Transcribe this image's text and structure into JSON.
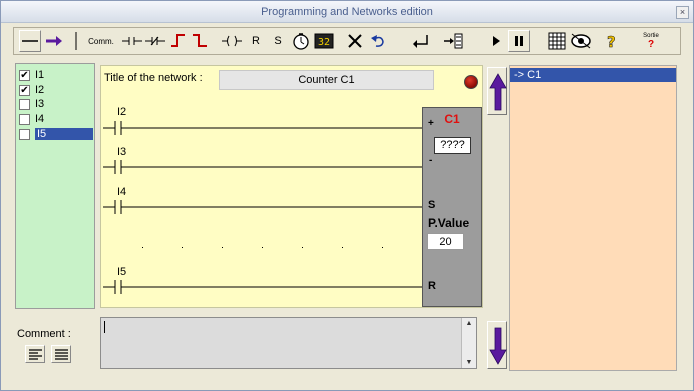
{
  "window": {
    "title": "Programming and Networks edition",
    "close_glyph": "×"
  },
  "toolbar": {
    "items": [
      {
        "name": "hline-tool",
        "text": ""
      },
      {
        "name": "arrow-tool",
        "text": ""
      },
      {
        "name": "vline-tool",
        "text": ""
      },
      {
        "name": "comment-tool",
        "text": "Comm."
      },
      {
        "name": "no-contact-tool",
        "text": ""
      },
      {
        "name": "nc-contact-tool",
        "text": ""
      },
      {
        "name": "rising-edge-tool",
        "text": ""
      },
      {
        "name": "falling-edge-tool",
        "text": ""
      },
      {
        "name": "coil-tool",
        "text": ""
      },
      {
        "name": "reset-coil-tool",
        "text": "R"
      },
      {
        "name": "set-coil-tool",
        "text": "S"
      },
      {
        "name": "timer-tool",
        "text": ""
      },
      {
        "name": "counter-tool",
        "text": ""
      },
      {
        "name": "delete-tool",
        "text": ""
      },
      {
        "name": "undo-tool",
        "text": ""
      },
      {
        "name": "enter-tool",
        "text": ""
      },
      {
        "name": "insert-network-tool",
        "text": ""
      },
      {
        "name": "run-tool",
        "text": ""
      },
      {
        "name": "pause-tool",
        "text": ""
      },
      {
        "name": "grid-tool",
        "text": ""
      },
      {
        "name": "view-tool",
        "text": ""
      },
      {
        "name": "help-tool",
        "text": ""
      },
      {
        "name": "exit-tool",
        "text": "Sortie"
      }
    ]
  },
  "inputs": {
    "items": [
      {
        "label": "I1",
        "checked": "✔"
      },
      {
        "label": "I2",
        "checked": "✔"
      },
      {
        "label": "I3",
        "checked": ""
      },
      {
        "label": "I4",
        "checked": ""
      },
      {
        "label": "I5",
        "checked": ""
      }
    ]
  },
  "network": {
    "title_label": "Title of the network :",
    "title_value": "Counter C1",
    "contacts": [
      {
        "label": "I2"
      },
      {
        "label": "I3"
      },
      {
        "label": "I4"
      },
      {
        "label": "I5"
      }
    ],
    "counter": {
      "name": "C1",
      "plus": "+",
      "minus": "-",
      "current_value": "????",
      "set_label": "S",
      "preset_label": "P.Value",
      "preset_value": "20",
      "reset_label": "R"
    }
  },
  "networks_list": {
    "items": [
      "->  C1"
    ]
  },
  "comment": {
    "label": "Comment :",
    "value": "",
    "scroll_up": "▲",
    "scroll_down": "▼"
  },
  "colors": {
    "ladder_bg": "#fffdc4",
    "inputs_bg": "#c8f2c8",
    "list_bg": "#ffdcb8",
    "selection": "#3355aa",
    "counter_name": "#e01010",
    "arrow": "#5a1a9e"
  }
}
